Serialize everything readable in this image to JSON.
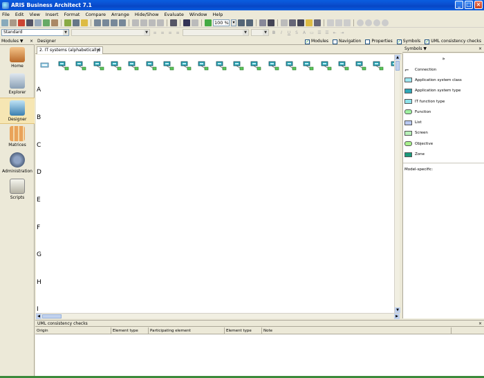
{
  "window": {
    "title": "ARIS Business Architect 7.1",
    "controls": [
      "_",
      "□",
      "×"
    ]
  },
  "menu": [
    "File",
    "Edit",
    "View",
    "Insert",
    "Format",
    "Compare",
    "Arrange",
    "Hide/Show",
    "Evaluate",
    "Window",
    "Help"
  ],
  "toolbar": {
    "zoom": "100 %",
    "zoom_arrow": "▾"
  },
  "format_bar": {
    "style": "Standard",
    "bold": "B",
    "italic": "I",
    "underline": "U"
  },
  "modules": {
    "header": "Modules ▼",
    "close": "×",
    "items": [
      {
        "label": "Home",
        "icon": "home-icon"
      },
      {
        "label": "Explorer",
        "icon": "explorer-icon"
      },
      {
        "label": "Designer",
        "icon": "designer-icon",
        "active": true
      },
      {
        "label": "Matrices",
        "icon": "matrices-icon"
      },
      {
        "label": "Administration",
        "icon": "administration-icon"
      },
      {
        "label": "Scripts",
        "icon": "scripts-icon"
      }
    ]
  },
  "designer": {
    "header": "Designer",
    "checkboxes": [
      {
        "label": "Modules",
        "checked": true
      },
      {
        "label": "Navigation",
        "checked": false
      },
      {
        "label": "Properties",
        "checked": false
      },
      {
        "label": "Symbols",
        "checked": true
      },
      {
        "label": "UML consistency checks",
        "checked": true
      }
    ],
    "tab": "2. IT systems (alphabetically)",
    "tab_close": "×",
    "row_letters": [
      "A",
      "B",
      "C",
      "D",
      "E",
      "F",
      "G",
      "H",
      "I"
    ]
  },
  "symbols": {
    "header": "Symbols ▼",
    "close": "×",
    "more": "»",
    "items": [
      {
        "label": "Connection",
        "color": "#ffffff"
      },
      {
        "label": "Application system class",
        "color": "#9fe6f0"
      },
      {
        "label": "Application system type",
        "color": "#2fa8b8"
      },
      {
        "label": "IT function type",
        "color": "#8fe3ea"
      },
      {
        "label": "Function",
        "color": "#9ff09f"
      },
      {
        "label": "List",
        "color": "#b8c8f0"
      },
      {
        "label": "Screen",
        "color": "#b8f0b8"
      },
      {
        "label": "Objective",
        "color": "#a8f08c"
      },
      {
        "label": "Zone",
        "color": "#1a9a7a"
      }
    ],
    "model_specific": "Model-specific:"
  },
  "uml_panel": {
    "header": "UML consistency checks",
    "close": "×",
    "columns": [
      "Origin",
      "Element type",
      "Participating element",
      "Element type",
      "Note"
    ]
  }
}
